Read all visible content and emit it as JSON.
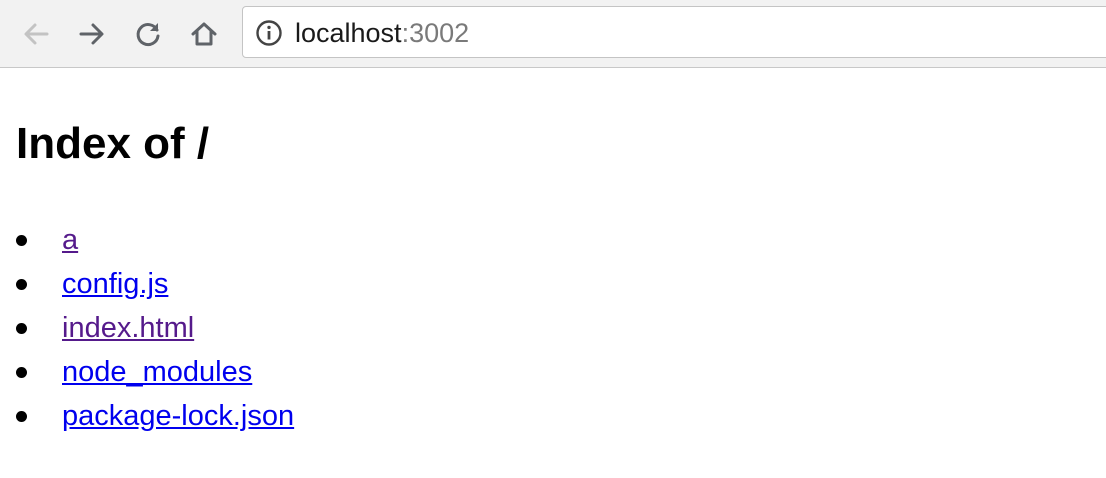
{
  "browser": {
    "url_host": "localhost",
    "url_port": ":3002",
    "icons": {
      "back": "arrow-left-icon",
      "forward": "arrow-right-icon",
      "reload": "reload-icon",
      "home": "home-icon",
      "site_info": "info-circle-icon"
    }
  },
  "page": {
    "title": "Index of /",
    "entries": [
      {
        "label": "a",
        "visited": true
      },
      {
        "label": "config.js",
        "visited": false
      },
      {
        "label": "index.html",
        "visited": true
      },
      {
        "label": "node_modules",
        "visited": false
      },
      {
        "label": "package-lock.json",
        "visited": false
      }
    ]
  },
  "colors": {
    "link_visited": "#551a8b",
    "link_unvisited": "#0000ee",
    "toolbar_bg": "#f2f2f2"
  }
}
